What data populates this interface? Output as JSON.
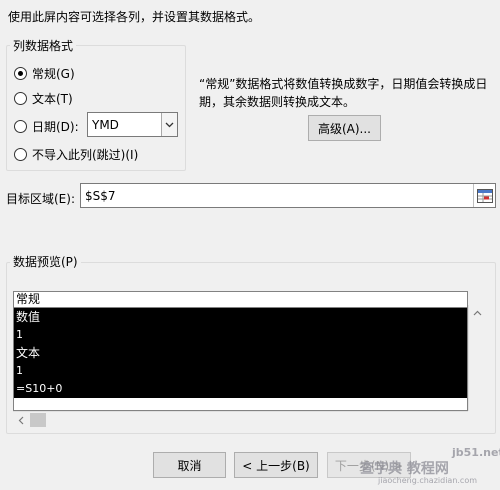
{
  "instruction": "使用此屏内容可选择各列，并设置其数据格式。",
  "column_format": {
    "legend": "列数据格式",
    "options": [
      {
        "label": "常规(G)",
        "checked": true
      },
      {
        "label": "文本(T)",
        "checked": false
      },
      {
        "label": "日期(D):",
        "checked": false
      },
      {
        "label": "不导入此列(跳过)(I)",
        "checked": false
      }
    ],
    "date_select_value": "YMD"
  },
  "description": {
    "line1": "“常规”数据格式将数值转换成数字，日期值会转换成日",
    "line2": "期，其余数据则转换成文本。"
  },
  "advanced_button": "高级(A)...",
  "target": {
    "label": "目标区域(E):",
    "value": "$S$7",
    "ref_icon": "range-select-icon"
  },
  "preview": {
    "legend": "数据预览(P)",
    "header": "常规",
    "rows": [
      "数值",
      "1",
      "文本",
      "1",
      "=S10+0"
    ]
  },
  "buttons": {
    "cancel": "取消",
    "back": "< 上一步(B)",
    "next": "下一步(N) >"
  },
  "watermark": {
    "line1": "jb51.net",
    "line2": "查字典 教程网",
    "line3": "jiaocheng.chazidian.com"
  }
}
